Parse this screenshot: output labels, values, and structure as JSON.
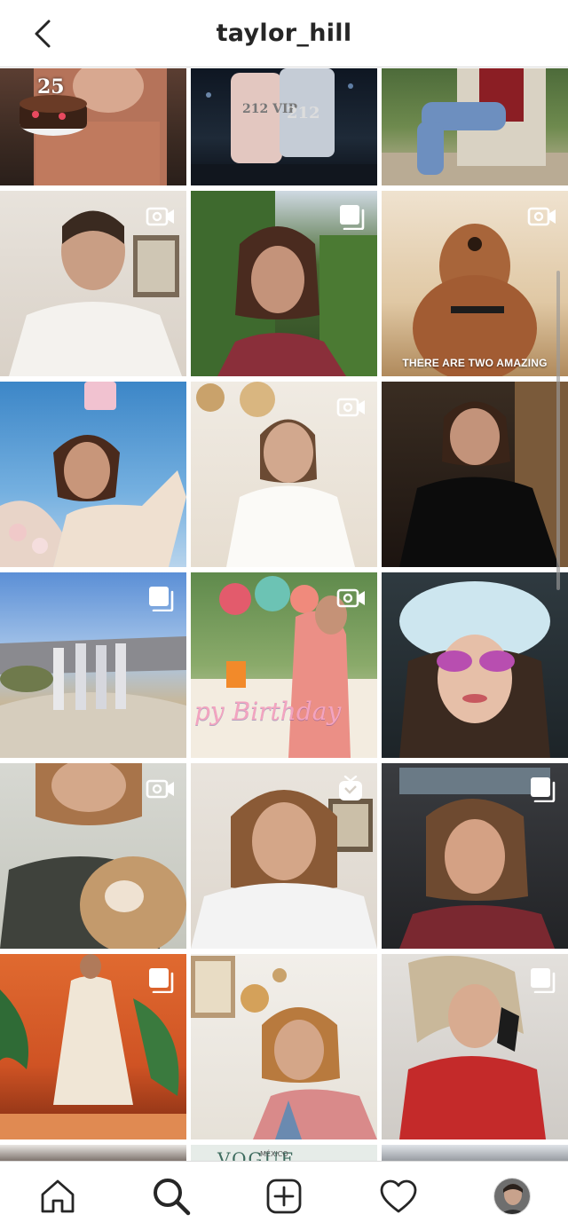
{
  "header": {
    "title": "taylor_hill",
    "back_icon": "chevron-left-icon"
  },
  "grid": {
    "posts": [
      {
        "name": "post-birthday-cake",
        "type": "image",
        "overlay_text": "25"
      },
      {
        "name": "post-perfume",
        "type": "image",
        "overlay_text": "212 VIP",
        "overlay_text2": "212"
      },
      {
        "name": "post-chair-garden",
        "type": "image"
      },
      {
        "name": "post-video-white-shirt",
        "type": "video",
        "icon": "video-camera-icon"
      },
      {
        "name": "post-hedge-portrait",
        "type": "carousel",
        "icon": "carousel-icon"
      },
      {
        "name": "post-dog-video",
        "type": "video",
        "icon": "video-camera-icon",
        "caption": "THERE ARE TWO AMAZING"
      },
      {
        "name": "post-perfume-sky",
        "type": "image"
      },
      {
        "name": "post-video-sweater",
        "type": "video",
        "icon": "video-camera-icon"
      },
      {
        "name": "post-black-outfit",
        "type": "image"
      },
      {
        "name": "post-desert-group",
        "type": "carousel",
        "icon": "carousel-icon"
      },
      {
        "name": "post-birthday-party",
        "type": "video",
        "icon": "video-camera-icon",
        "overlay_text": "py Birthday"
      },
      {
        "name": "post-child-sunglasses",
        "type": "image"
      },
      {
        "name": "post-dog-selfie",
        "type": "video",
        "icon": "video-camera-icon"
      },
      {
        "name": "post-igtv-striped-shirt",
        "type": "igtv",
        "icon": "igtv-icon"
      },
      {
        "name": "post-car-portrait",
        "type": "carousel",
        "icon": "carousel-icon"
      },
      {
        "name": "post-runway-dress",
        "type": "carousel",
        "icon": "carousel-icon"
      },
      {
        "name": "post-striped-top",
        "type": "image"
      },
      {
        "name": "post-headscarf-phone",
        "type": "carousel",
        "icon": "carousel-icon"
      },
      {
        "name": "post-partial-1",
        "type": "image"
      },
      {
        "name": "post-vogue-mexico",
        "type": "image",
        "overlay_text": "VOGUE",
        "overlay_text2": "MÉXICO"
      },
      {
        "name": "post-partial-3",
        "type": "image"
      }
    ]
  },
  "tabbar": {
    "items": [
      {
        "name": "tab-home",
        "icon": "home-icon"
      },
      {
        "name": "tab-search",
        "icon": "search-icon",
        "active": true
      },
      {
        "name": "tab-new-post",
        "icon": "plus-square-icon"
      },
      {
        "name": "tab-activity",
        "icon": "heart-icon"
      },
      {
        "name": "tab-profile",
        "icon": "avatar"
      }
    ]
  },
  "colors": {
    "text": "#262626",
    "border": "#dbdbdb",
    "background": "#ffffff"
  }
}
